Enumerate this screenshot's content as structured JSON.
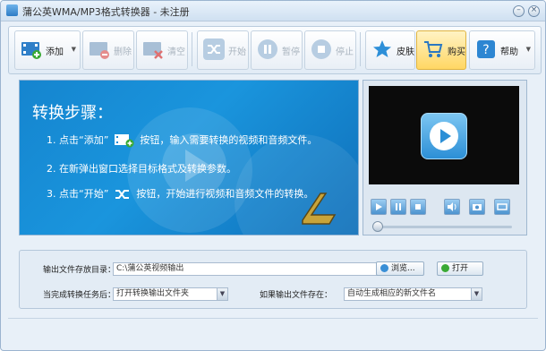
{
  "window": {
    "title": "蒲公英WMA/MP3格式转换器 - 未注册"
  },
  "toolbar": {
    "add": "添加",
    "delete": "删除",
    "clear": "清空",
    "start": "开始",
    "pause": "暂停",
    "stop": "停止",
    "skin": "皮肤",
    "buy": "购买",
    "help": "帮助"
  },
  "banner": {
    "heading": "转换步骤：",
    "step1_pre": "1. 点击“添加”",
    "step1_post": "按钮，输入需要转换的视频和音频文件。",
    "step2": "2. 在新弹出窗口选择目标格式及转换参数。",
    "step3_pre": "3. 点击“开始”",
    "step3_post": "按钮，开始进行视频和音频文件的转换。"
  },
  "settings": {
    "output_dir_label": "输出文件存放目录：",
    "output_dir_value": "C:\\蒲公英视频输出",
    "browse": "浏览...",
    "open": "打开",
    "after_task_label": "当完成转换任务后：",
    "after_task_value": "打开转换输出文件夹",
    "if_exists_label": "如果输出文件存在：",
    "if_exists_value": "自动生成相应的新文件名"
  },
  "colors": {
    "accent": "#1a8ad6",
    "buy_highlight": "#ffd764",
    "screen": "#0b0b0b"
  }
}
